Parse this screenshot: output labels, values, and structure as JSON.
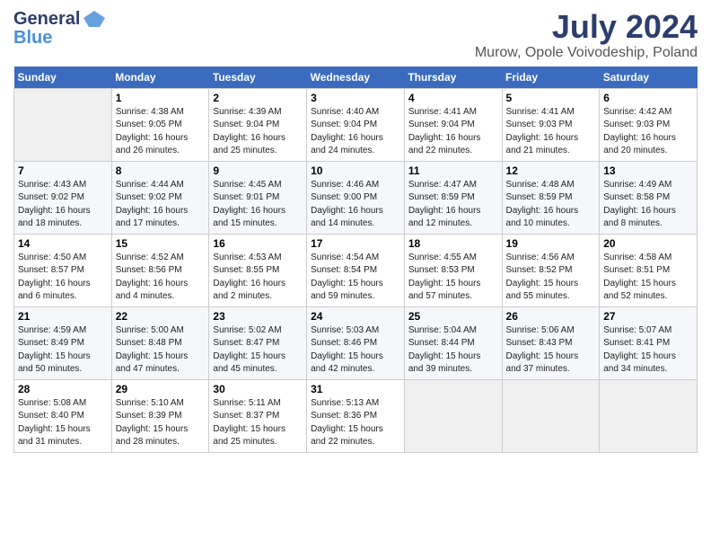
{
  "header": {
    "logo_general": "General",
    "logo_blue": "Blue",
    "title": "July 2024",
    "location": "Murow, Opole Voivodeship, Poland"
  },
  "days_of_week": [
    "Sunday",
    "Monday",
    "Tuesday",
    "Wednesday",
    "Thursday",
    "Friday",
    "Saturday"
  ],
  "weeks": [
    [
      {
        "day": "",
        "info": ""
      },
      {
        "day": "1",
        "info": "Sunrise: 4:38 AM\nSunset: 9:05 PM\nDaylight: 16 hours\nand 26 minutes."
      },
      {
        "day": "2",
        "info": "Sunrise: 4:39 AM\nSunset: 9:04 PM\nDaylight: 16 hours\nand 25 minutes."
      },
      {
        "day": "3",
        "info": "Sunrise: 4:40 AM\nSunset: 9:04 PM\nDaylight: 16 hours\nand 24 minutes."
      },
      {
        "day": "4",
        "info": "Sunrise: 4:41 AM\nSunset: 9:04 PM\nDaylight: 16 hours\nand 22 minutes."
      },
      {
        "day": "5",
        "info": "Sunrise: 4:41 AM\nSunset: 9:03 PM\nDaylight: 16 hours\nand 21 minutes."
      },
      {
        "day": "6",
        "info": "Sunrise: 4:42 AM\nSunset: 9:03 PM\nDaylight: 16 hours\nand 20 minutes."
      }
    ],
    [
      {
        "day": "7",
        "info": "Sunrise: 4:43 AM\nSunset: 9:02 PM\nDaylight: 16 hours\nand 18 minutes."
      },
      {
        "day": "8",
        "info": "Sunrise: 4:44 AM\nSunset: 9:02 PM\nDaylight: 16 hours\nand 17 minutes."
      },
      {
        "day": "9",
        "info": "Sunrise: 4:45 AM\nSunset: 9:01 PM\nDaylight: 16 hours\nand 15 minutes."
      },
      {
        "day": "10",
        "info": "Sunrise: 4:46 AM\nSunset: 9:00 PM\nDaylight: 16 hours\nand 14 minutes."
      },
      {
        "day": "11",
        "info": "Sunrise: 4:47 AM\nSunset: 8:59 PM\nDaylight: 16 hours\nand 12 minutes."
      },
      {
        "day": "12",
        "info": "Sunrise: 4:48 AM\nSunset: 8:59 PM\nDaylight: 16 hours\nand 10 minutes."
      },
      {
        "day": "13",
        "info": "Sunrise: 4:49 AM\nSunset: 8:58 PM\nDaylight: 16 hours\nand 8 minutes."
      }
    ],
    [
      {
        "day": "14",
        "info": "Sunrise: 4:50 AM\nSunset: 8:57 PM\nDaylight: 16 hours\nand 6 minutes."
      },
      {
        "day": "15",
        "info": "Sunrise: 4:52 AM\nSunset: 8:56 PM\nDaylight: 16 hours\nand 4 minutes."
      },
      {
        "day": "16",
        "info": "Sunrise: 4:53 AM\nSunset: 8:55 PM\nDaylight: 16 hours\nand 2 minutes."
      },
      {
        "day": "17",
        "info": "Sunrise: 4:54 AM\nSunset: 8:54 PM\nDaylight: 15 hours\nand 59 minutes."
      },
      {
        "day": "18",
        "info": "Sunrise: 4:55 AM\nSunset: 8:53 PM\nDaylight: 15 hours\nand 57 minutes."
      },
      {
        "day": "19",
        "info": "Sunrise: 4:56 AM\nSunset: 8:52 PM\nDaylight: 15 hours\nand 55 minutes."
      },
      {
        "day": "20",
        "info": "Sunrise: 4:58 AM\nSunset: 8:51 PM\nDaylight: 15 hours\nand 52 minutes."
      }
    ],
    [
      {
        "day": "21",
        "info": "Sunrise: 4:59 AM\nSunset: 8:49 PM\nDaylight: 15 hours\nand 50 minutes."
      },
      {
        "day": "22",
        "info": "Sunrise: 5:00 AM\nSunset: 8:48 PM\nDaylight: 15 hours\nand 47 minutes."
      },
      {
        "day": "23",
        "info": "Sunrise: 5:02 AM\nSunset: 8:47 PM\nDaylight: 15 hours\nand 45 minutes."
      },
      {
        "day": "24",
        "info": "Sunrise: 5:03 AM\nSunset: 8:46 PM\nDaylight: 15 hours\nand 42 minutes."
      },
      {
        "day": "25",
        "info": "Sunrise: 5:04 AM\nSunset: 8:44 PM\nDaylight: 15 hours\nand 39 minutes."
      },
      {
        "day": "26",
        "info": "Sunrise: 5:06 AM\nSunset: 8:43 PM\nDaylight: 15 hours\nand 37 minutes."
      },
      {
        "day": "27",
        "info": "Sunrise: 5:07 AM\nSunset: 8:41 PM\nDaylight: 15 hours\nand 34 minutes."
      }
    ],
    [
      {
        "day": "28",
        "info": "Sunrise: 5:08 AM\nSunset: 8:40 PM\nDaylight: 15 hours\nand 31 minutes."
      },
      {
        "day": "29",
        "info": "Sunrise: 5:10 AM\nSunset: 8:39 PM\nDaylight: 15 hours\nand 28 minutes."
      },
      {
        "day": "30",
        "info": "Sunrise: 5:11 AM\nSunset: 8:37 PM\nDaylight: 15 hours\nand 25 minutes."
      },
      {
        "day": "31",
        "info": "Sunrise: 5:13 AM\nSunset: 8:36 PM\nDaylight: 15 hours\nand 22 minutes."
      },
      {
        "day": "",
        "info": ""
      },
      {
        "day": "",
        "info": ""
      },
      {
        "day": "",
        "info": ""
      }
    ]
  ]
}
